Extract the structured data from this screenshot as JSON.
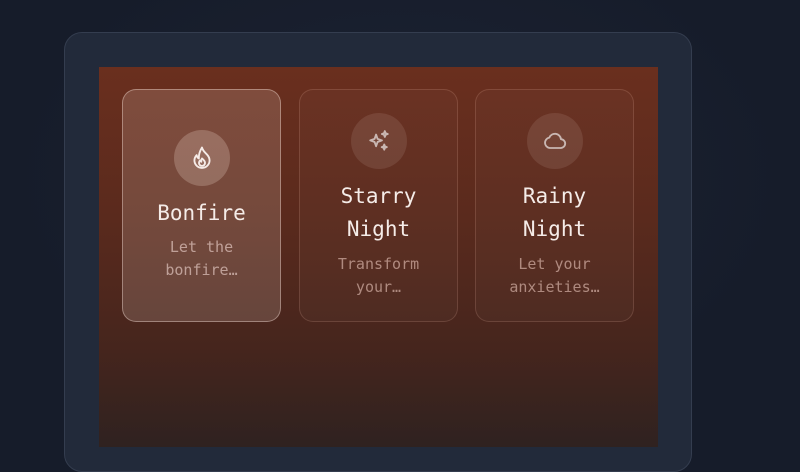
{
  "scenes": [
    {
      "title": "Bonfire",
      "description": "Let the bonfire…",
      "icon": "fire-icon",
      "selected": true
    },
    {
      "title": "Starry Night",
      "description": "Transform your…",
      "icon": "sparkles-icon",
      "selected": false
    },
    {
      "title": "Rainy Night",
      "description": "Let your anxieties…",
      "icon": "cloud-icon",
      "selected": false
    }
  ],
  "colors": {
    "background": "#161c2a",
    "frame": "#222a3a",
    "screen_top": "#6a2f1e",
    "screen_bottom": "#2f2220",
    "title_text": "#f5ece8"
  }
}
